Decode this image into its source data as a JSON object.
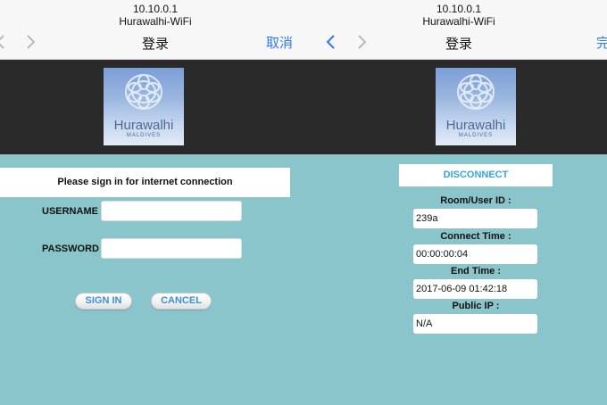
{
  "left": {
    "navbar": {
      "ip": "10.10.0.1",
      "ssid": "Hurawalhi-WiFi",
      "title": "登录",
      "cancel_label": "取消"
    },
    "logo": {
      "name": "Hurawalhi",
      "sub": "MALDIVES"
    },
    "signin_heading": "Please sign in for internet connection",
    "username_label": "USERNAME",
    "password_label": "PASSWORD",
    "username_value": "",
    "password_value": "",
    "signin_button": "SIGN IN",
    "cancel_button": "CANCEL"
  },
  "right": {
    "navbar": {
      "ip": "10.10.0.1",
      "ssid": "Hurawalhi-WiFi",
      "title": "登录",
      "done_label": "完"
    },
    "logo": {
      "name": "Hurawalhi",
      "sub": "MALDIVES"
    },
    "disconnect_button": "DISCONNECT",
    "room_label": "Room/User ID :",
    "room_value": "239a",
    "connect_time_label": "Connect Time :",
    "connect_time_value": "00:00:00:04",
    "end_time_label": "End Time :",
    "end_time_value": "2017-06-09 01:42:18",
    "public_ip_label": "Public IP :",
    "public_ip_value": "N/A"
  },
  "colors": {
    "page_bg": "#8ac5cc",
    "banner_bg": "#2a2a2a",
    "nav_accent": "#2f7bf6",
    "button_text": "#3d8fd8",
    "disconnect_text": "#37a6dc"
  },
  "icons": [
    "chevron-left-icon",
    "chevron-right-icon",
    "hurawalhi-logo"
  ]
}
